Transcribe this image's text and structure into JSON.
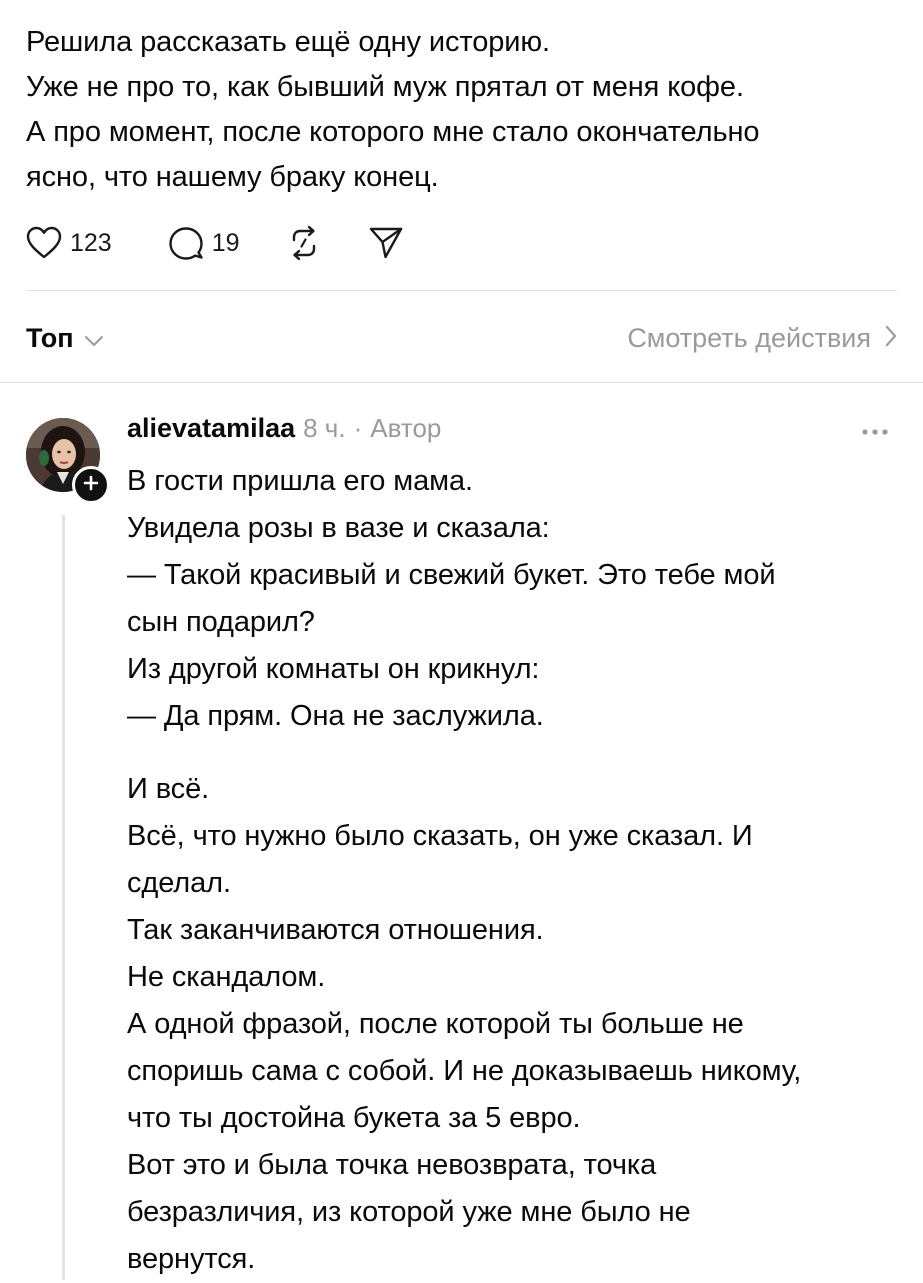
{
  "post": {
    "lines": [
      "Решила рассказать ещё одну историю.",
      "Уже не про то, как бывший муж прятал от меня кофе.",
      "А про момент, после которого мне стало окончательно",
      "ясно, что нашему браку конец."
    ]
  },
  "actions": {
    "likes": "123",
    "comments": "19",
    "icons": [
      "heart-icon",
      "comment-icon",
      "repost-icon",
      "share-icon"
    ]
  },
  "sort": {
    "label": "Топ",
    "view_activity": "Смотреть действия"
  },
  "comment": {
    "username": "alievatamilaa",
    "time": "8 ч.",
    "separator": "·",
    "role": "Автор",
    "paragraph1": [
      "В гости пришла его мама.",
      "Увидела розы в вазе и сказала:",
      "— Такой красивый и свежий букет. Это тебе мой",
      "сын подарил?",
      "Из другой комнаты он крикнул:",
      "— Да прям. Она не заслужила."
    ],
    "paragraph2": [
      "И всё.",
      "Всё, что нужно было сказать, он уже сказал. И",
      "сделал.",
      "Так заканчиваются отношения.",
      "Не скандалом.",
      "А одной фразой, после которой ты больше не",
      "споришь сама с собой. И не доказываешь никому,",
      "что ты достойна букета за 5 евро.",
      "Вот это и была точка невозврата, точка",
      "безразличия, из которой уже мне было не",
      "вернутся."
    ]
  },
  "colors": {
    "text": "#0a0a0a",
    "muted": "#9a9a9a",
    "divider": "#e4e4e4",
    "thread": "#e3e3e3",
    "badge": "#111111"
  }
}
